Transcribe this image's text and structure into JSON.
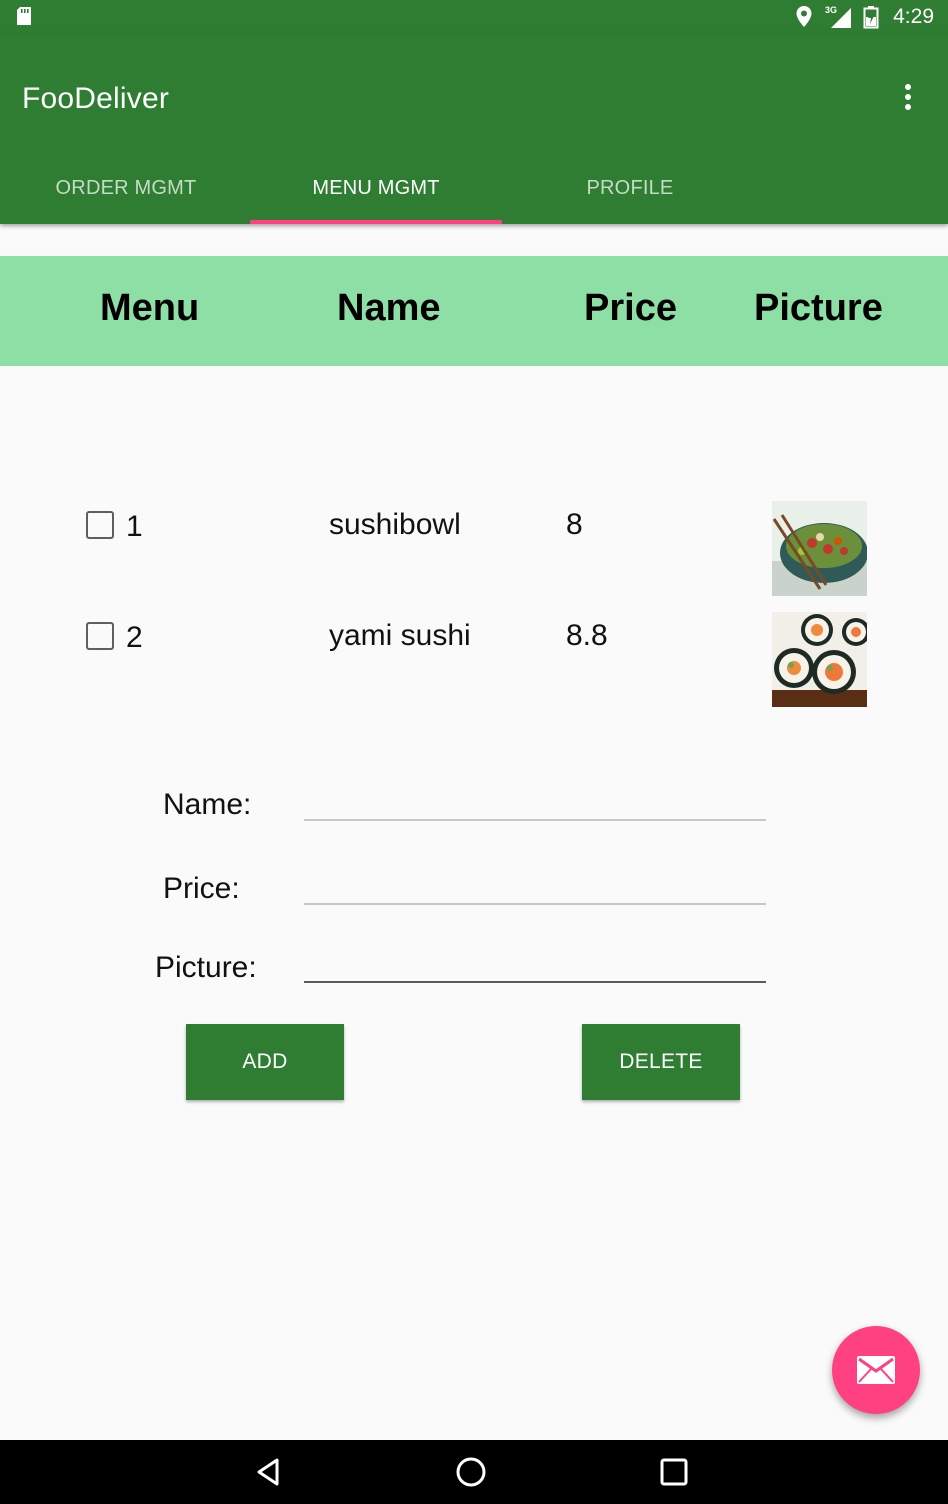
{
  "status_bar": {
    "time": "4:29",
    "network": "3G"
  },
  "app": {
    "title": "FooDeliver"
  },
  "tabs": [
    {
      "label": "ORDER MGMT",
      "active": false
    },
    {
      "label": "MENU MGMT",
      "active": true
    },
    {
      "label": "PROFILE",
      "active": false
    }
  ],
  "table": {
    "headers": [
      "Menu",
      "Name",
      "Price",
      "Picture"
    ],
    "rows": [
      {
        "id": "1",
        "name": "sushibowl",
        "price": "8",
        "picture": "sushibowl-photo",
        "checked": false
      },
      {
        "id": "2",
        "name": "yami sushi",
        "price": "8.8",
        "picture": "sushi-roll-photo",
        "checked": false
      }
    ]
  },
  "form": {
    "name_label": "Name:",
    "price_label": "Price:",
    "picture_label": "Picture:",
    "name_value": "",
    "price_value": "",
    "picture_value": ""
  },
  "buttons": {
    "add": "ADD",
    "delete": "DELETE"
  },
  "fab": {
    "icon": "mail-icon"
  },
  "colors": {
    "primary": "#2e7d32",
    "accent": "#ff4081",
    "header_bg": "#8ddfa5"
  }
}
